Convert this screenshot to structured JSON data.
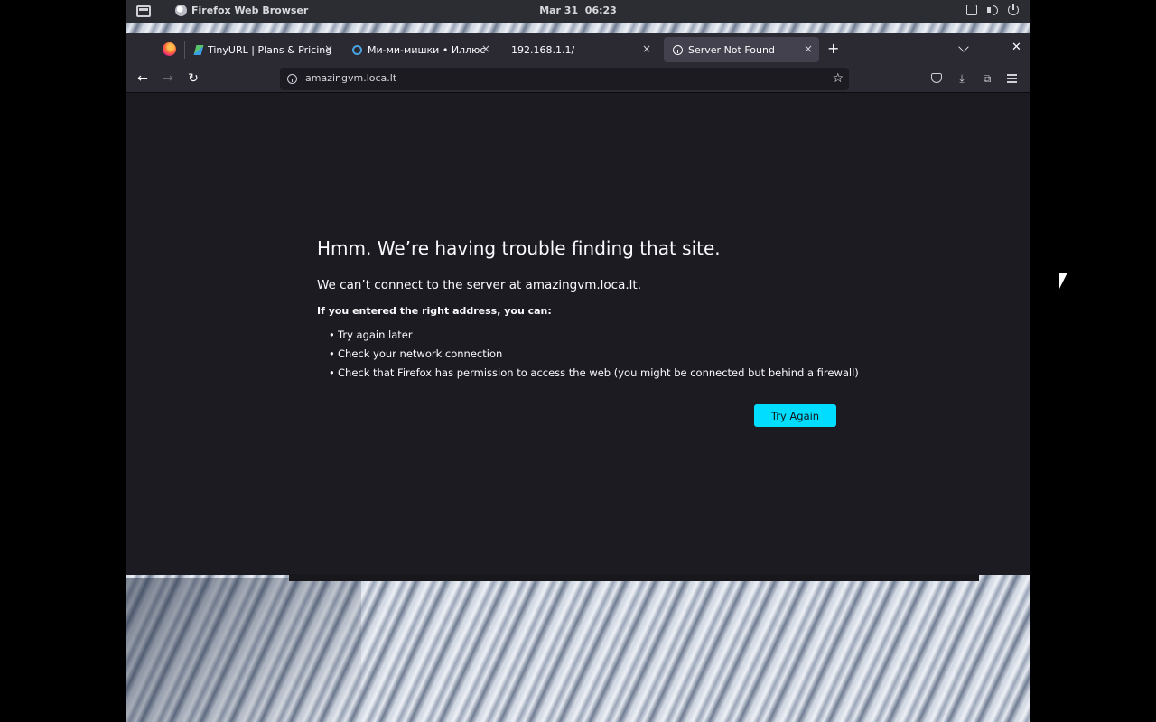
{
  "system_bar": {
    "app_name": "Firefox Web Browser",
    "date": "Mar 31",
    "time": "06:23"
  },
  "tabs": [
    {
      "label": "TinyURL | Plans & Pricing",
      "favicon": "tinyurl-icon",
      "active": false
    },
    {
      "label": "Ми-ми-мишки • Иллюстр",
      "favicon": "ring-icon",
      "active": false
    },
    {
      "label": "192.168.1.1/",
      "favicon": "none",
      "active": false
    },
    {
      "label": "Server Not Found",
      "favicon": "info-icon",
      "active": true
    }
  ],
  "navbar": {
    "url": "amazingvm.loca.lt"
  },
  "error_page": {
    "title": "Hmm. We’re having trouble finding that site.",
    "description": "We can’t connect to the server at amazingvm.loca.lt.",
    "subheading": "If you entered the right address, you can:",
    "suggestions": [
      "Try again later",
      "Check your network connection",
      "Check that Firefox has permission to access the web (you might be connected but behind a firewall)"
    ],
    "button_label": "Try Again"
  },
  "colors": {
    "accent": "#00ddff",
    "page_background": "#1c1b22",
    "toolbar_background": "#2b2a33"
  }
}
